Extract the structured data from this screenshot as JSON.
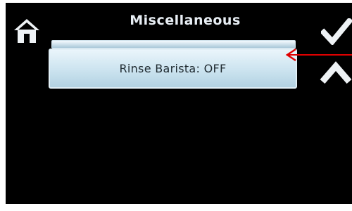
{
  "header": {
    "title": "Miscellaneous"
  },
  "icons": {
    "home": "home-icon",
    "confirm": "checkmark-icon",
    "scroll_up": "chevron-up-icon",
    "annotation": "red-arrow-annotation"
  },
  "menu": {
    "items": [
      {
        "label": "Rinse Barista: OFF"
      }
    ]
  },
  "colors": {
    "screen_bg": "#000000",
    "button_face": "#cbe3ef",
    "text": "#1f2a30",
    "annotation": "#e00000"
  }
}
